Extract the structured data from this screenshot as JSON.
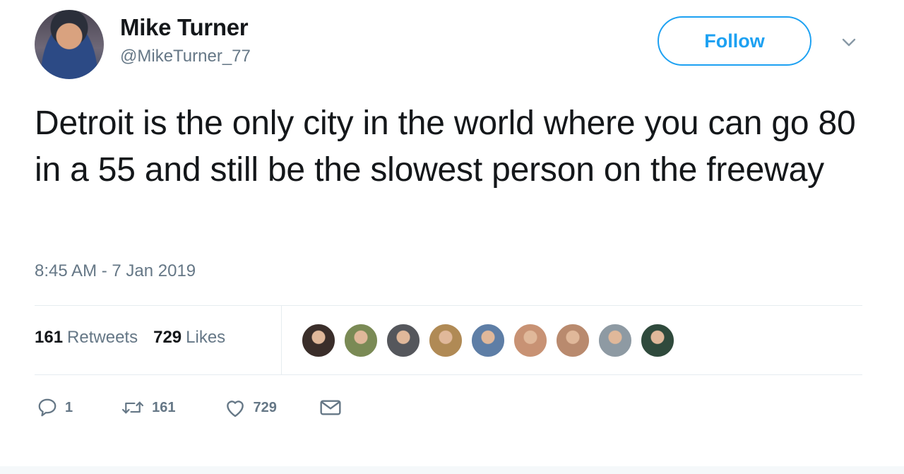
{
  "user": {
    "name": "Mike Turner",
    "handle": "@MikeTurner_77"
  },
  "follow_button": {
    "label": "Follow"
  },
  "tweet": {
    "text": "Detroit is the only city in the world where you can go 80 in a 55 and still be the slowest person on the freeway",
    "timestamp": "8:45 AM - 7 Jan 2019"
  },
  "stats": {
    "retweets_count": "161",
    "retweets_label": "Retweets",
    "likes_count": "729",
    "likes_label": "Likes"
  },
  "likers": [
    {
      "color": "#3a2e2a"
    },
    {
      "color": "#7a8a55"
    },
    {
      "color": "#55575c"
    },
    {
      "color": "#b08a55"
    },
    {
      "color": "#5e7ea6"
    },
    {
      "color": "#c89274"
    },
    {
      "color": "#b98a6e"
    },
    {
      "color": "#8e9aa3"
    },
    {
      "color": "#2f4a3c"
    }
  ],
  "actions": {
    "reply_count": "1",
    "retweet_count": "161",
    "like_count": "729"
  },
  "colors": {
    "accent": "#1da1f2",
    "secondary_text": "#657786",
    "primary_text": "#14171a"
  }
}
